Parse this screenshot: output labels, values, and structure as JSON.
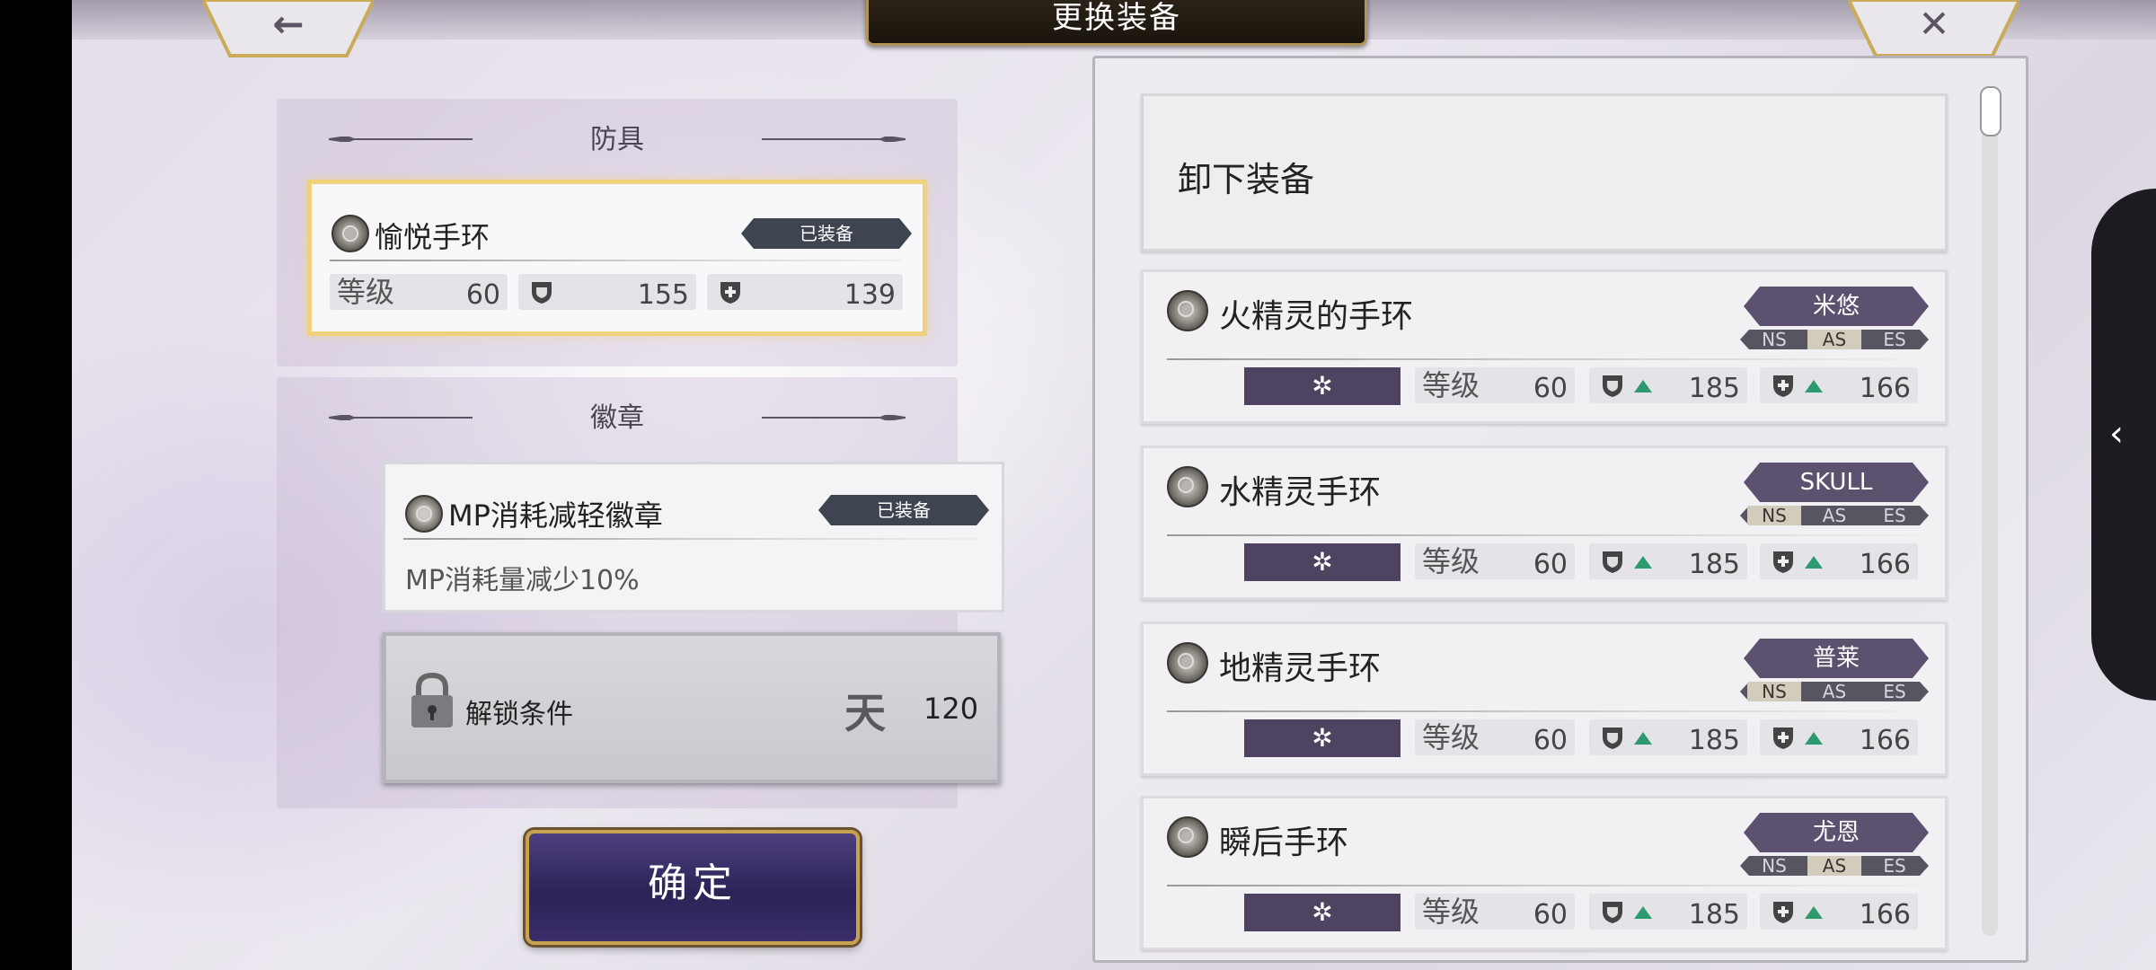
{
  "header": {
    "title": "更换装备",
    "back_glyph": "←",
    "close_glyph": "✕"
  },
  "armor_section": {
    "heading": "防具",
    "equipped": {
      "name": "愉悦手环",
      "tag": "已装备",
      "level_label": "等级",
      "level": "60",
      "def1": "155",
      "def2": "139"
    }
  },
  "badge_section": {
    "heading": "徽章",
    "equipped": {
      "name": "MP消耗减轻徽章",
      "tag": "已装备",
      "description": "MP消耗量减少10%"
    },
    "locked": {
      "label": "解锁条件",
      "glyph": "天",
      "value": "120"
    }
  },
  "confirm_label": "确定",
  "unequip_label": "卸下装备",
  "level_label": "等级",
  "items": [
    {
      "name": "火精灵的手环",
      "owner": "米悠",
      "servers": [
        "NS",
        "AS",
        "ES"
      ],
      "active_server": "AS",
      "level": "60",
      "def1": "185",
      "def2": "166"
    },
    {
      "name": "水精灵手环",
      "owner": "SKULL",
      "servers": [
        "NS",
        "AS",
        "ES"
      ],
      "active_server": "NS",
      "level": "60",
      "def1": "185",
      "def2": "166"
    },
    {
      "name": "地精灵手环",
      "owner": "普莱",
      "servers": [
        "NS",
        "AS",
        "ES"
      ],
      "active_server": "NS",
      "level": "60",
      "def1": "185",
      "def2": "166"
    },
    {
      "name": "瞬后手环",
      "owner": "尤恩",
      "servers": [
        "NS",
        "AS",
        "ES"
      ],
      "active_server": "AS",
      "level": "60",
      "def1": "185",
      "def2": "166"
    }
  ],
  "element_glyph": "✲",
  "side_tab_glyph": "‹",
  "colors": {
    "accent_gold": "#f1d27c",
    "owner_tag": "#5d5170",
    "up_arrow": "#2e9a6f",
    "confirm_button": "#2d2356"
  }
}
